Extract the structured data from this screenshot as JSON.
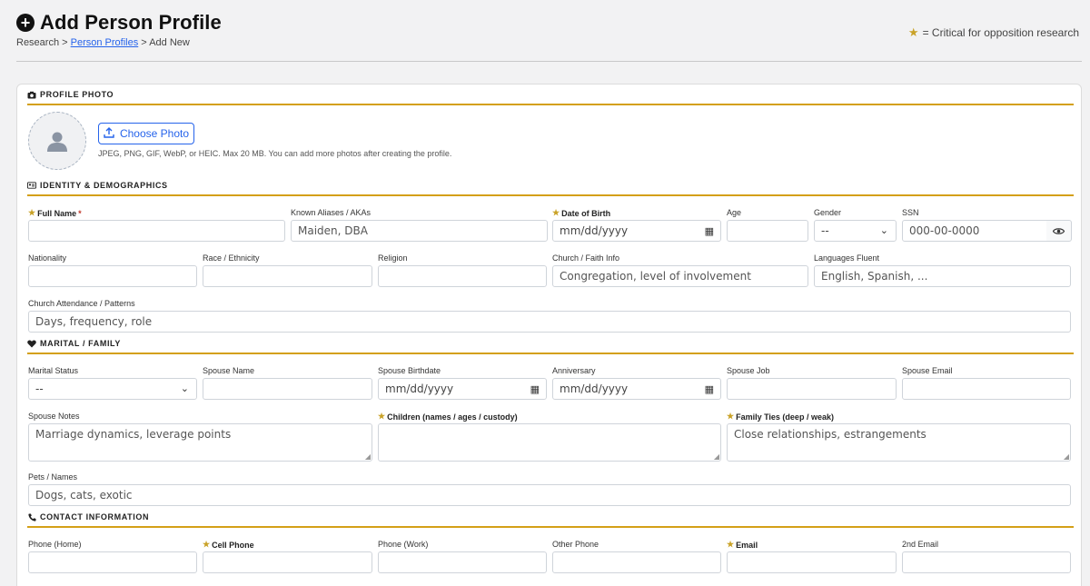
{
  "header": {
    "title": "Add Person Profile",
    "breadcrumb": {
      "root": "Research",
      "sep1": ">",
      "link": "Person Profiles",
      "sep2": ">",
      "current": "Add New"
    },
    "legend": "= Critical for opposition research"
  },
  "photo": {
    "section_title": "PROFILE PHOTO",
    "button_label": "Choose Photo",
    "help_text": "JPEG, PNG, GIF, WebP, or HEIC. Max 20 MB. You can add more photos after creating the profile."
  },
  "identity": {
    "section_title": "IDENTITY & DEMOGRAPHICS",
    "full_name_label": "Full Name",
    "required_mark": "*",
    "aliases_label": "Known Aliases / AKAs",
    "aliases_placeholder": "Maiden, DBA",
    "dob_label": "Date of Birth",
    "dob_placeholder": "mm/dd/yyyy",
    "age_label": "Age",
    "gender_label": "Gender",
    "gender_value": "--",
    "ssn_label": "SSN",
    "ssn_placeholder": "000-00-0000",
    "nationality_label": "Nationality",
    "race_label": "Race / Ethnicity",
    "religion_label": "Religion",
    "church_label": "Church / Faith Info",
    "church_placeholder": "Congregation, level of involvement",
    "languages_label": "Languages Fluent",
    "languages_placeholder": "English, Spanish, ...",
    "attendance_label": "Church Attendance / Patterns",
    "attendance_placeholder": "Days, frequency, role"
  },
  "family": {
    "section_title": "MARITAL / FAMILY",
    "marital_label": "Marital Status",
    "marital_value": "--",
    "spouse_name_label": "Spouse Name",
    "spouse_birthdate_label": "Spouse Birthdate",
    "spouse_birthdate_placeholder": "mm/dd/yyyy",
    "anniversary_label": "Anniversary",
    "anniversary_placeholder": "mm/dd/yyyy",
    "spouse_job_label": "Spouse Job",
    "spouse_email_label": "Spouse Email",
    "spouse_notes_label": "Spouse Notes",
    "spouse_notes_placeholder": "Marriage dynamics, leverage points",
    "children_label": "Children (names / ages / custody)",
    "family_ties_label": "Family Ties (deep / weak)",
    "family_ties_placeholder": "Close relationships, estrangements",
    "pets_label": "Pets / Names",
    "pets_placeholder": "Dogs, cats, exotic"
  },
  "contact": {
    "section_title": "CONTACT INFORMATION",
    "phone_home_label": "Phone (Home)",
    "cell_phone_label": "Cell Phone",
    "phone_work_label": "Phone (Work)",
    "other_phone_label": "Other Phone",
    "email_label": "Email",
    "email2_label": "2nd Email"
  },
  "colors": {
    "accent": "#d4a017",
    "star": "#c9a227",
    "link": "#2563eb"
  }
}
